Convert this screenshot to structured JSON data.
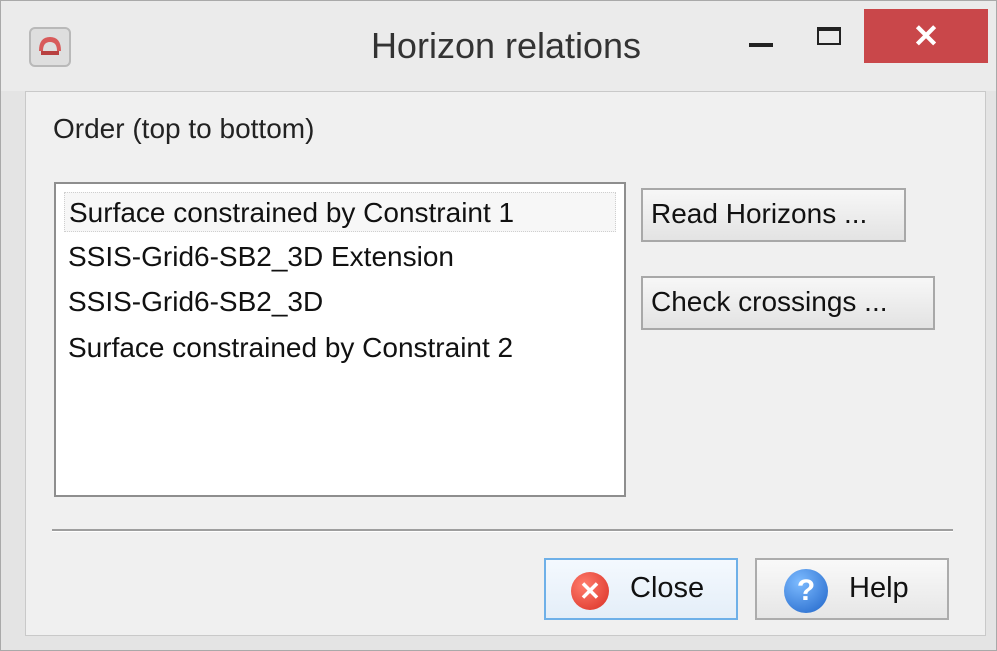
{
  "window": {
    "title": "Horizon relations",
    "close_glyph": "✕"
  },
  "order_label": "Order (top to bottom)",
  "horizons": [
    "Surface constrained by Constraint 1",
    "SSIS-Grid6-SB2_3D Extension",
    "SSIS-Grid6-SB2_3D",
    "Surface constrained by Constraint 2"
  ],
  "buttons": {
    "read_horizons": "Read Horizons ...",
    "check_crossings": "Check crossings ...",
    "close": "Close",
    "help": "Help"
  },
  "icons": {
    "app": "app-icon",
    "close_dialog": "close-icon",
    "help_dialog": "help-icon"
  },
  "colors": {
    "close_x_bg": "#c9474a",
    "primary_border": "#6eb0e8"
  }
}
